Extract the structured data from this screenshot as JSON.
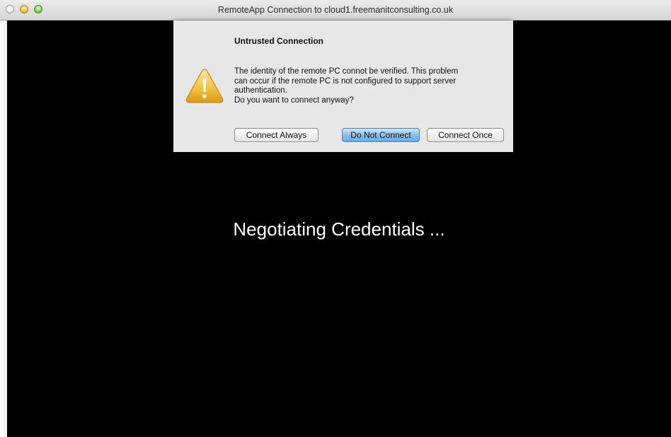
{
  "window": {
    "title": "RemoteApp Connection to cloud1.freemanitconsulting.co.uk"
  },
  "dialog": {
    "title": "Untrusted Connection",
    "message": "The identity of the remote PC connot be verified. This problem\ncan occur if the remote PC is not configured to support server\nauthentication.\nDo you want to connect anyway?",
    "icon": "warning-icon",
    "buttons": {
      "connect_always": "Connect Always",
      "do_not_connect": "Do Not Connect",
      "connect_once": "Connect Once"
    }
  },
  "status": {
    "text": "Negotiating Credentials ..."
  },
  "colors": {
    "background": "#000000",
    "default_button": "#84bde9",
    "warning_icon": "#f5c43c"
  }
}
